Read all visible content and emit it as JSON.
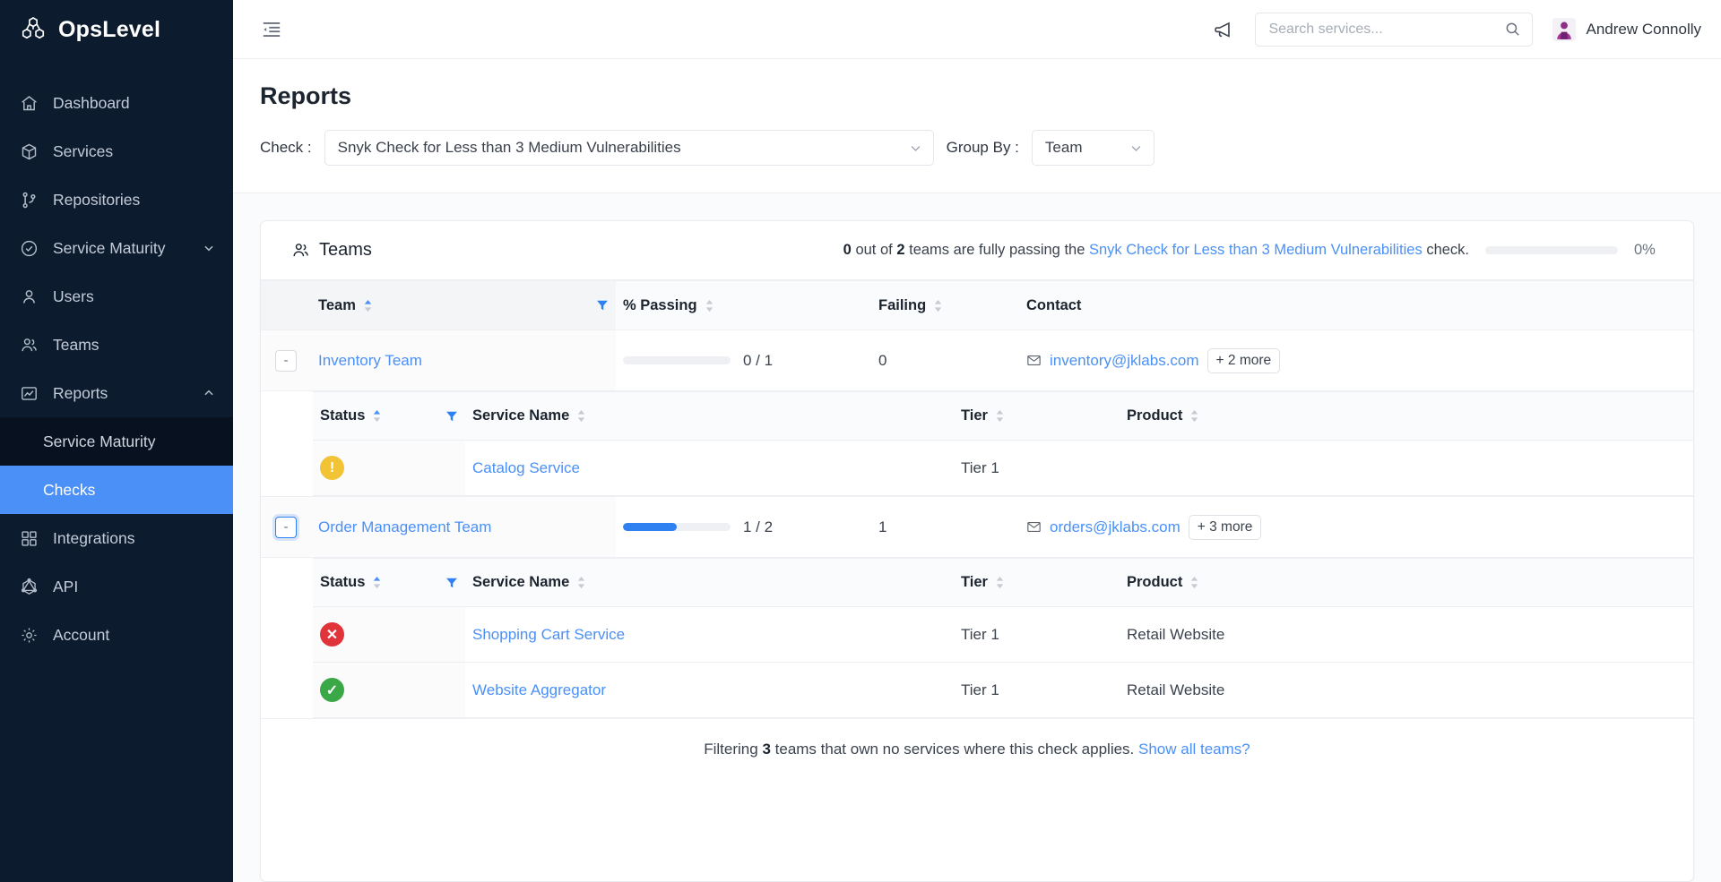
{
  "brand": {
    "name": "OpsLevel",
    "logo_icon": "cubes-logo-icon"
  },
  "sidebar": {
    "items": [
      {
        "label": "Dashboard",
        "icon": "home-icon"
      },
      {
        "label": "Services",
        "icon": "cube-icon"
      },
      {
        "label": "Repositories",
        "icon": "branch-icon"
      },
      {
        "label": "Service Maturity",
        "icon": "check-circle-icon",
        "caret": "chevron-down-icon"
      },
      {
        "label": "Users",
        "icon": "user-icon"
      },
      {
        "label": "Teams",
        "icon": "users-icon"
      },
      {
        "label": "Reports",
        "icon": "chart-icon",
        "caret": "chevron-up-icon"
      }
    ],
    "sub_items": [
      {
        "label": "Service Maturity",
        "active": false
      },
      {
        "label": "Checks",
        "active": true
      }
    ],
    "items_after": [
      {
        "label": "Integrations",
        "icon": "grid-icon"
      },
      {
        "label": "API",
        "icon": "graphql-icon"
      },
      {
        "label": "Account",
        "icon": "gear-icon"
      }
    ]
  },
  "topbar": {
    "collapse_icon": "collapse-sidebar-icon",
    "announcement_icon": "megaphone-icon",
    "search": {
      "placeholder": "Search services...",
      "value": "",
      "icon": "search-icon"
    },
    "user": {
      "name": "Andrew Connolly",
      "avatar_icon": "avatar"
    }
  },
  "page": {
    "title": "Reports",
    "check_filter_label": "Check :",
    "check_filter_value": "Snyk Check for Less than 3 Medium Vulnerabilities",
    "group_by_label": "Group By :",
    "group_by_value": "Team"
  },
  "card": {
    "title": "Teams",
    "title_icon": "users-icon",
    "summary": {
      "passing_count": "0",
      "mid_text_1": "out of",
      "total_count": "2",
      "mid_text_2": "teams are fully passing the",
      "check_link": "Snyk Check for Less than 3 Medium Vulnerabilities",
      "mid_text_3": "check.",
      "progress_percent": 0,
      "percent_label": "0%"
    }
  },
  "teams_table": {
    "columns": [
      "Team",
      "% Passing",
      "Failing",
      "Contact"
    ],
    "sorted_column": "Team",
    "rows": [
      {
        "expander": "-",
        "expander_focused": false,
        "team": "Inventory Team",
        "passing_numerator": 0,
        "passing_denominator": 1,
        "passing_percent": 0,
        "passing_label": "0 / 1",
        "failing": "0",
        "contact_email": "inventory@jklabs.com",
        "contact_more": "+ 2 more",
        "services_columns": [
          "Status",
          "Service Name",
          "Tier",
          "Product"
        ],
        "services": [
          {
            "status": "warning",
            "status_glyph": "!",
            "name": "Catalog Service",
            "tier": "Tier 1",
            "product": ""
          }
        ]
      },
      {
        "expander": "-",
        "expander_focused": true,
        "team": "Order Management Team",
        "passing_numerator": 1,
        "passing_denominator": 2,
        "passing_percent": 50,
        "passing_label": "1 / 2",
        "failing": "1",
        "contact_email": "orders@jklabs.com",
        "contact_more": "+ 3 more",
        "services_columns": [
          "Status",
          "Service Name",
          "Tier",
          "Product"
        ],
        "services": [
          {
            "status": "fail",
            "status_glyph": "✕",
            "name": "Shopping Cart Service",
            "tier": "Tier 1",
            "product": "Retail Website"
          },
          {
            "status": "pass",
            "status_glyph": "✓",
            "name": "Website Aggregator",
            "tier": "Tier 1",
            "product": "Retail Website"
          }
        ]
      }
    ]
  },
  "footer": {
    "text_1": "Filtering",
    "count": "3",
    "text_2": "teams that own no services where this check applies.",
    "link": "Show all teams?"
  },
  "colors": {
    "sidebar_bg": "#0d1b2e",
    "accent_blue": "#4a90f7",
    "progress_blue": "#2f80f0",
    "status_warning": "#f2c335",
    "status_fail": "#e0333a",
    "status_pass": "#3aa846"
  }
}
